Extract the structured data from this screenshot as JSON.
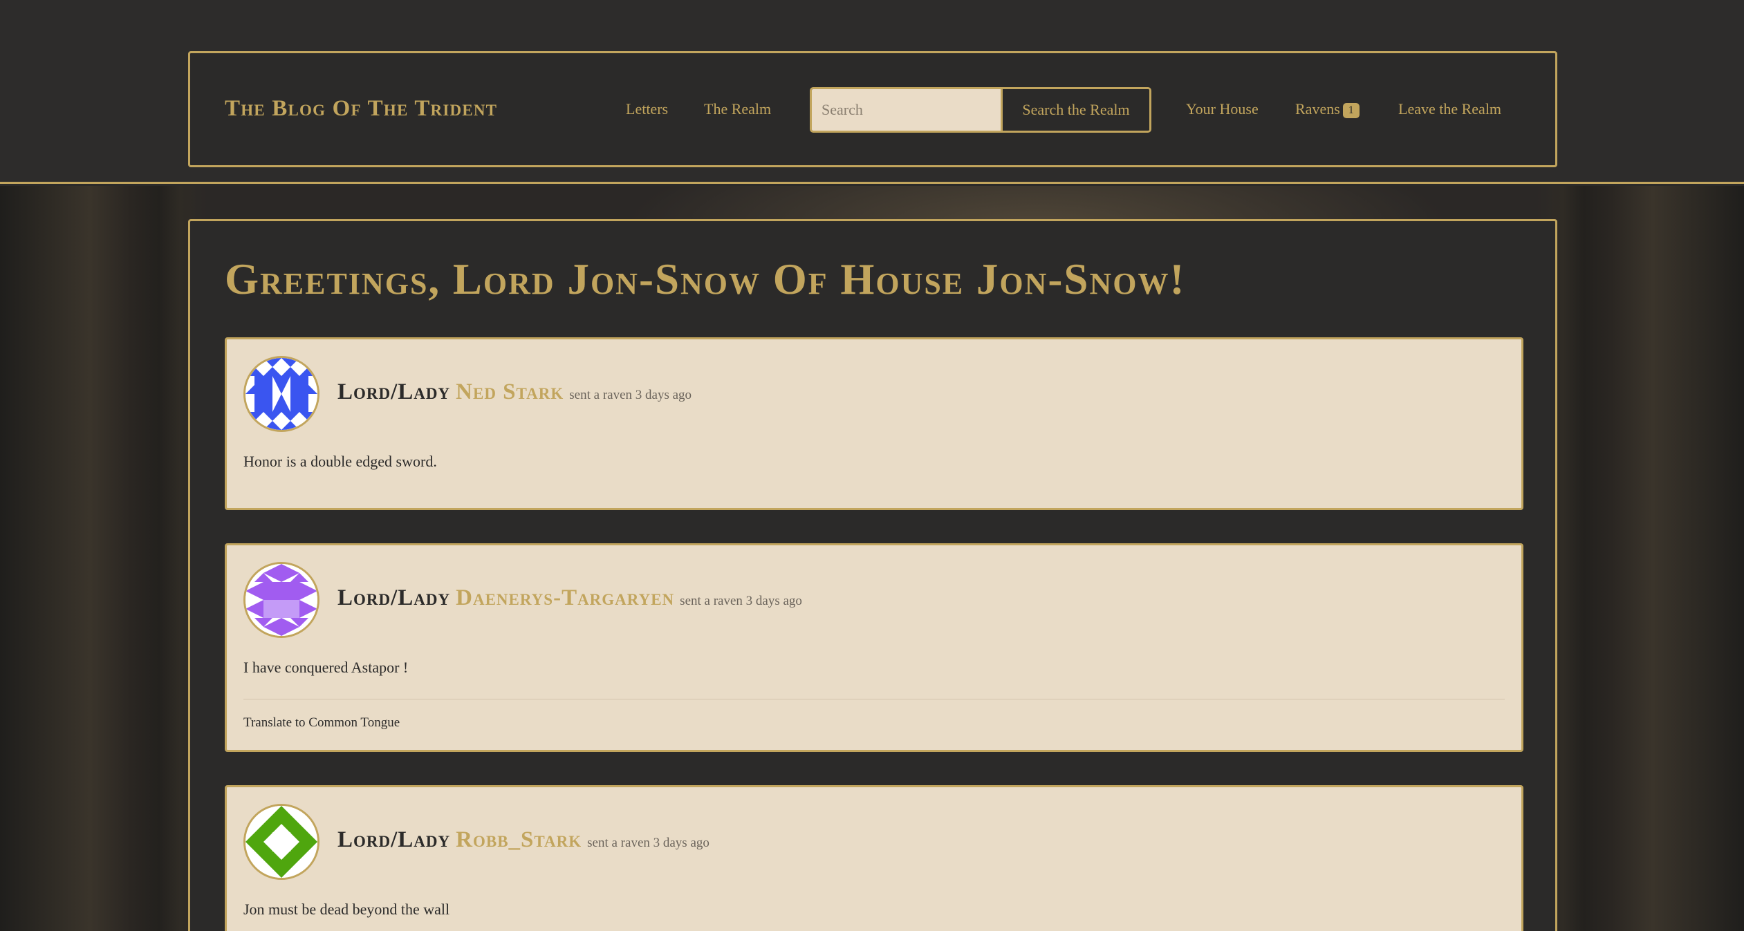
{
  "brand": "The Blog Of The Trident",
  "nav": {
    "letters": "Letters",
    "realm": "The Realm",
    "search_placeholder": "Search",
    "search_button": "Search the Realm",
    "your_house": "Your House",
    "ravens": "Ravens",
    "ravens_count": "1",
    "leave": "Leave the Realm"
  },
  "greeting": "Greetings, Lord Jon-Snow Of House Jon-Snow!",
  "posts": [
    {
      "prefix": "Lord/Lady",
      "user": "Ned Stark",
      "meta": "sent a raven 3 days ago",
      "body": "Honor is a double edged sword.",
      "avatar_color": "#3a55f0"
    },
    {
      "prefix": "Lord/Lady",
      "user": "Daenerys-Targaryen",
      "meta": "sent a raven 3 days ago",
      "body": "I have conquered Astapor !",
      "translate": "Translate to Common Tongue",
      "avatar_color": "#a15cf0"
    },
    {
      "prefix": "Lord/Lady",
      "user": "Robb_Stark",
      "meta": "sent a raven 3 days ago",
      "body": "Jon must be dead beyond the wall",
      "avatar_color": "#4fa60e"
    }
  ],
  "colors": {
    "gold": "#c2a55d",
    "dark": "#2b2a29",
    "parchment": "#e9dcc7"
  }
}
